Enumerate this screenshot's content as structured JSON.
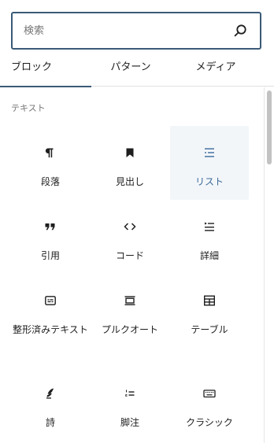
{
  "search": {
    "placeholder": "検索"
  },
  "tabs": [
    {
      "label": "ブロック",
      "selected": true
    },
    {
      "label": "パターン",
      "selected": false
    },
    {
      "label": "メディア",
      "selected": false
    }
  ],
  "category": {
    "title": "テキスト"
  },
  "blocks": [
    {
      "label": "段落",
      "icon": "paragraph-icon"
    },
    {
      "label": "見出し",
      "icon": "heading-bookmark-icon"
    },
    {
      "label": "リスト",
      "icon": "list-icon",
      "selected": true
    },
    {
      "label": "引用",
      "icon": "quote-icon"
    },
    {
      "label": "コード",
      "icon": "code-icon"
    },
    {
      "label": "詳細",
      "icon": "details-icon"
    },
    {
      "label": "整形済みテキスト",
      "icon": "preformatted-icon"
    },
    {
      "label": "プルクオート",
      "icon": "pullquote-icon"
    },
    {
      "label": "テーブル",
      "icon": "table-icon"
    },
    {
      "label": "詩",
      "icon": "verse-feather-icon"
    },
    {
      "label": "脚注",
      "icon": "footnotes-icon"
    },
    {
      "label": "クラシック",
      "icon": "keyboard-icon"
    }
  ],
  "colors": {
    "accent": "#3a5a77",
    "selected_bg": "#f3f6f9",
    "selected_text": "#3a6a9a",
    "muted": "#757575"
  }
}
